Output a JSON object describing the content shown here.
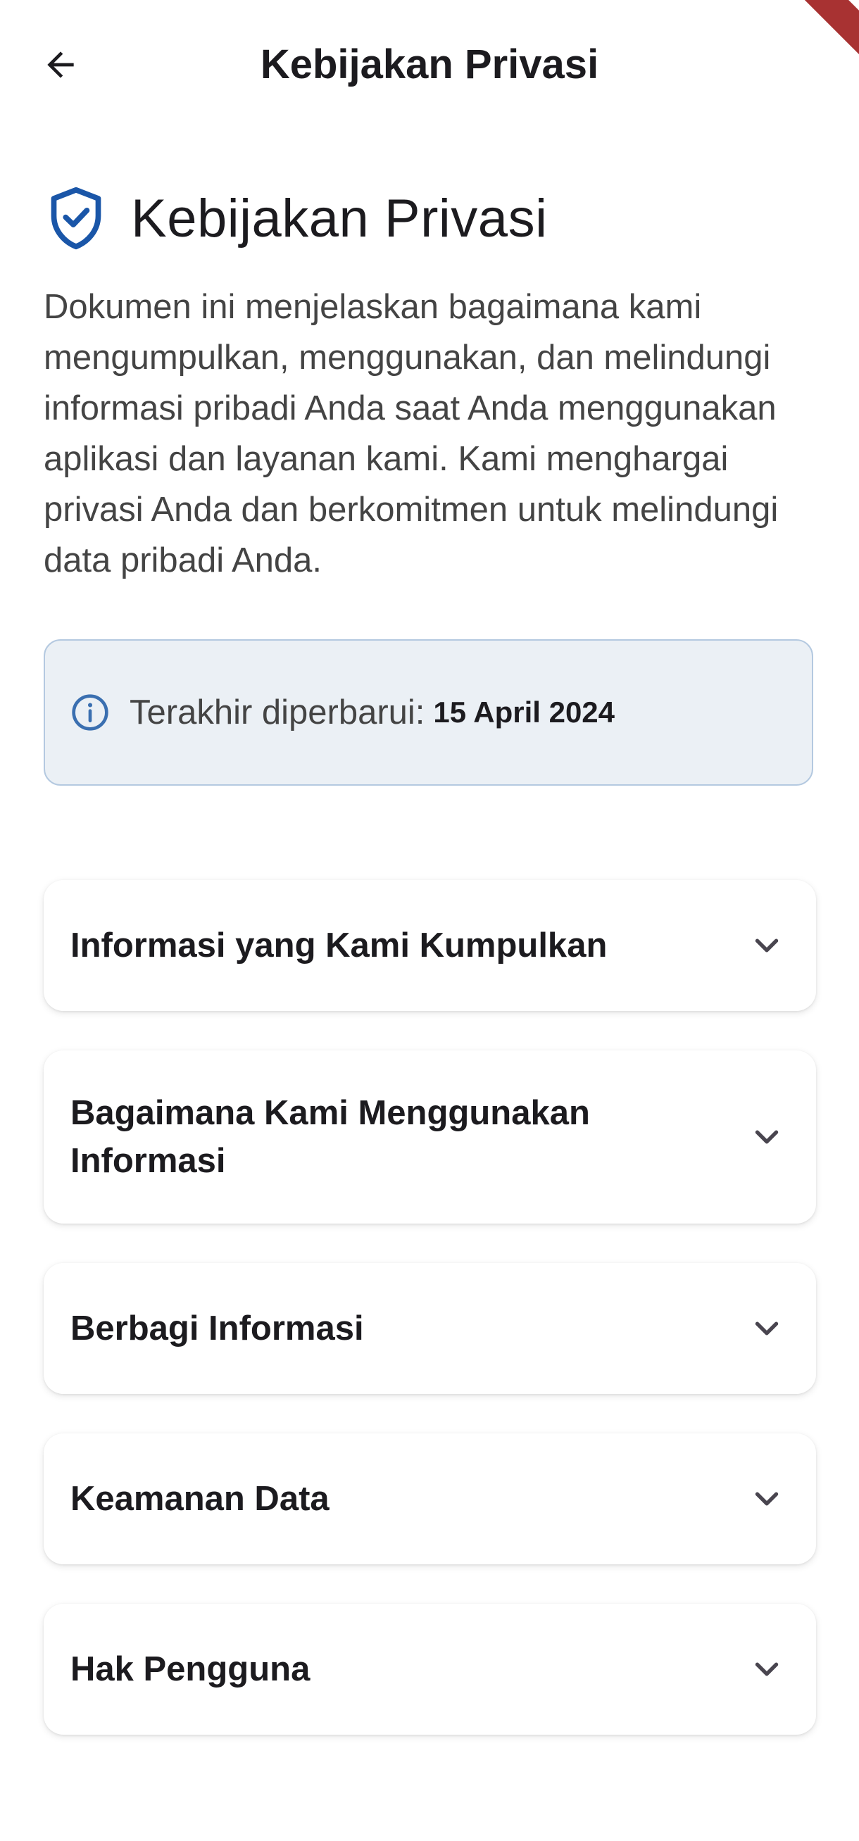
{
  "app_bar": {
    "title": "Kebijakan Privasi",
    "back_icon": "arrow-left-icon"
  },
  "header": {
    "icon": "shield-check-icon",
    "title": "Kebijakan Privasi",
    "accent_color": "#1a56a8"
  },
  "intro_text": "Dokumen ini menjelaskan bagaimana kami mengumpulkan, menggunakan, dan melindungi informasi pribadi Anda saat Anda menggunakan aplikasi dan layanan kami. Kami menghargai privasi Anda dan berkomitmen untuk melindungi data pribadi Anda.",
  "last_updated": {
    "icon": "info-icon",
    "label": "Terakhir diperbarui:",
    "date": "15 April 2024"
  },
  "sections": [
    {
      "title": "Informasi yang Kami Kumpulkan",
      "icon": "chevron-down-icon"
    },
    {
      "title": "Bagaimana Kami Menggunakan Informasi",
      "icon": "chevron-down-icon"
    },
    {
      "title": "Berbagi Informasi",
      "icon": "chevron-down-icon"
    },
    {
      "title": "Keamanan Data",
      "icon": "chevron-down-icon"
    },
    {
      "title": "Hak Pengguna",
      "icon": "chevron-down-icon"
    }
  ]
}
